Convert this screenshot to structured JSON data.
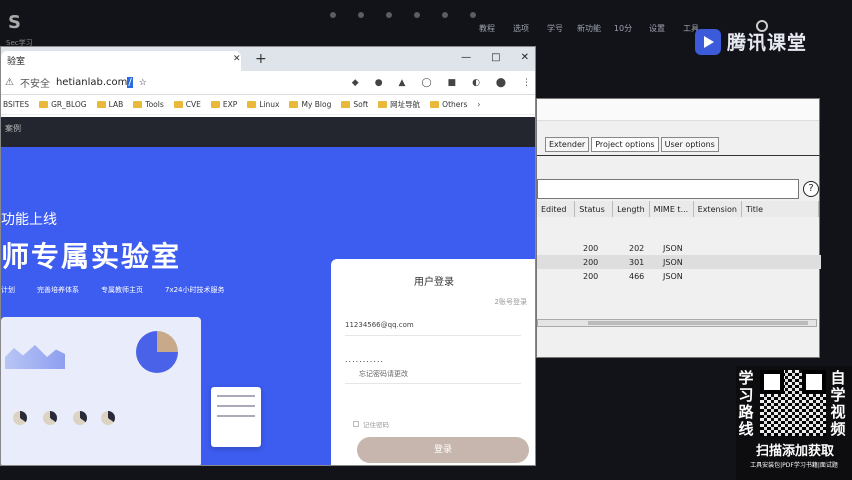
{
  "desktop": {
    "logo_sub": "Sec学习",
    "dock_items": [
      "教程",
      "选项",
      "学号",
      "新功能",
      "10分",
      "设置",
      "工具"
    ],
    "brand": "腾讯课堂"
  },
  "browser": {
    "tab_title": "验室",
    "window_controls": [
      "—",
      "□",
      "✕"
    ],
    "address": {
      "security_label": "不安全",
      "url_prefix": "hetianlab.com",
      "url_selected": "/"
    },
    "bookmarks": [
      "BSITES",
      "GR_BLOG",
      "LAB",
      "Tools",
      "CVE",
      "EXP",
      "Linux",
      "My Blog",
      "Soft",
      "网址导航",
      "Others"
    ],
    "page_header": "案例",
    "hero": {
      "subtitle": "功能上线",
      "title": "师专属实验室",
      "features": [
        "计划",
        "完善培养体系",
        "专属教师主页",
        "7x24小时技术服务"
      ]
    },
    "login": {
      "title": "用户登录",
      "alt_link": "2账号登录",
      "email": "11234566@qq.com",
      "password": "...........",
      "forgot": "忘记密码请更改",
      "remember": "记住密码",
      "submit": "登录"
    }
  },
  "burp": {
    "tabs": [
      "Extender",
      "Project options",
      "User options"
    ],
    "help": "?",
    "columns": [
      "Edited",
      "Status",
      "Length",
      "MIME t...",
      "Extension",
      "Title"
    ],
    "rows": [
      {
        "status": "200",
        "length": "202",
        "mime": "JSON"
      },
      {
        "status": "200",
        "length": "301",
        "mime": "JSON"
      },
      {
        "status": "200",
        "length": "466",
        "mime": "JSON"
      }
    ]
  },
  "ad": {
    "left_text": "学习路线",
    "right_text": "自学视频",
    "cta": "扫描添加获取",
    "small": "工具安装包|PDF学习书籍|面试题"
  }
}
